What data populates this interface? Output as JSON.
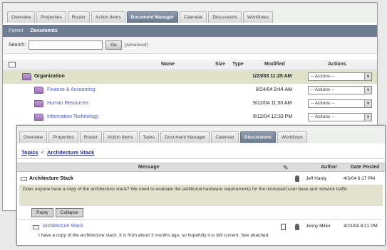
{
  "doc_window": {
    "tabs": [
      "Overview",
      "Properties",
      "Roster",
      "Action Items",
      "Document Manager",
      "Calendar",
      "Discussions",
      "Workflows"
    ],
    "active_tab": "Document Manager",
    "subnav": {
      "parent": "Parent",
      "current": "Documents"
    },
    "search": {
      "label": "Search:",
      "value": "",
      "placeholder": "",
      "go_label": "Go",
      "advanced_label": "[Advanced]"
    },
    "columns": {
      "name": "Name",
      "size": "Size",
      "type": "Type",
      "modified": "Modified",
      "actions": "Actions"
    },
    "rows": [
      {
        "name": "Organization",
        "modified": "1/23/03 11:25 AM",
        "action": "-- Actions --"
      },
      {
        "name": "Finance & Accounting",
        "modified": "8/24/04 9:44 AM",
        "action": "-- Actions --"
      },
      {
        "name": "Human Resources",
        "modified": "9/12/04 11:50 AM",
        "action": "-- Actions --"
      },
      {
        "name": "Information Technology",
        "modified": "9/12/04 12:33 PM",
        "action": "-- Actions --"
      }
    ]
  },
  "disc_window": {
    "tabs": [
      "Overview",
      "Properties",
      "Roster",
      "Action Items",
      "Tasks",
      "Document Manager",
      "Calendar",
      "Discussions",
      "Workflows"
    ],
    "active_tab": "Discussions",
    "breadcrumb": {
      "parent": "Topics",
      "separator": "<",
      "current": "Architecture Stack"
    },
    "columns": {
      "message": "Message",
      "author": "Author",
      "date": "Date Posted"
    },
    "thread": {
      "title": "Architecture Stack",
      "author": "Jeff Hardy",
      "date": "4/3/04 6:17 PM",
      "body": "Does anyone have a copy of the architecture stack? We need to evaluate the additional hardware requirements for the increased user base and network traffic."
    },
    "buttons": {
      "reply": "Reply",
      "collapse": "Collapse"
    },
    "reply": {
      "title": "Architecture Stack",
      "author": "Jenny Miller",
      "date": "4/23/04 8:21 PM",
      "body": "I have a copy of the architecture stack. It is from about 3 months ago, so hopefully it is still current. See attached."
    }
  }
}
